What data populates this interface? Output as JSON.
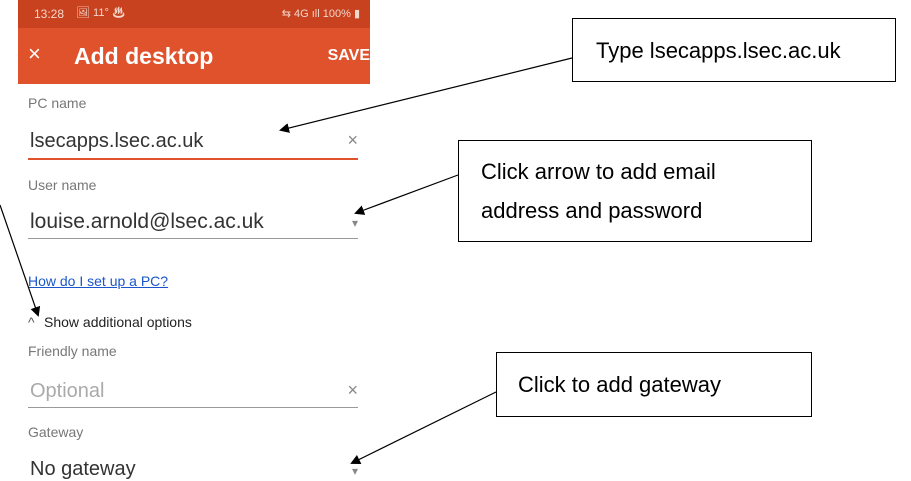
{
  "statusbar": {
    "time": "13:28",
    "icons": "🖼 11° ♨",
    "right": "⇆ 4G ıll 100% ▮"
  },
  "appbar": {
    "close": "×",
    "title": "Add desktop",
    "save": "SAVE"
  },
  "form": {
    "pc_label": "PC name",
    "pc_value": "lsecapps.lsec.ac.uk",
    "pc_clear": "×",
    "user_label": "User name",
    "user_value": "louise.arnold@lsec.ac.uk",
    "user_dropdown": "▾",
    "help_link": "How do I set up a PC?",
    "options_chevron": "^",
    "options_label": "Show additional options",
    "friendly_label": "Friendly name",
    "friendly_placeholder": "Optional",
    "friendly_clear": "×",
    "gateway_label": "Gateway",
    "gateway_value": "No gateway",
    "gateway_dropdown": "▾"
  },
  "annotations": {
    "type_host": "Type lsecapps.lsec.ac.uk",
    "click_arrow_line1": "Click arrow to add email",
    "click_arrow_line2": "address and password",
    "click_gateway": "Click to add gateway"
  },
  "colors": {
    "statusbar": "#c8421f",
    "appbar": "#e0522c",
    "accent_underline": "#e0522c",
    "link": "#1a56c9"
  }
}
